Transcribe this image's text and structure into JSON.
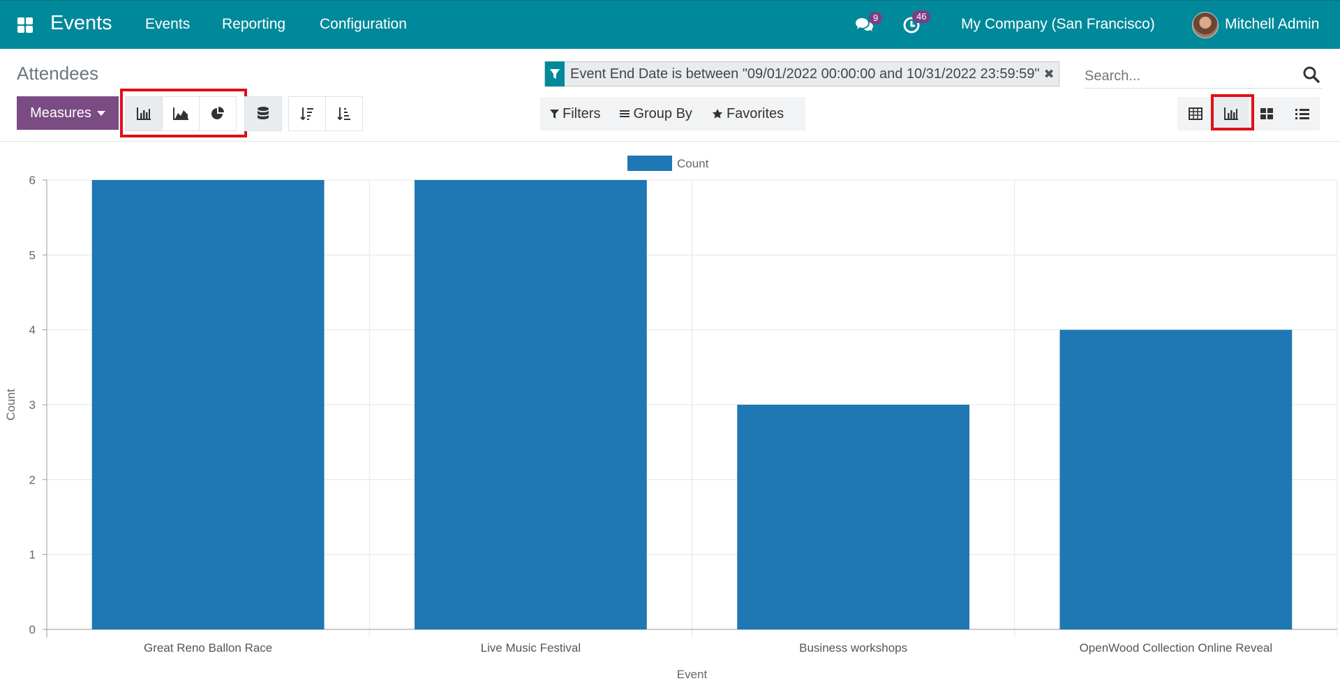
{
  "navbar": {
    "brand": "Events",
    "menu": [
      "Events",
      "Reporting",
      "Configuration"
    ],
    "messages_count": "9",
    "activities_count": "46",
    "company": "My Company (San Francisco)",
    "user": "Mitchell Admin"
  },
  "control_panel": {
    "breadcrumb": "Attendees",
    "measures_label": "Measures",
    "facet_text": "Event End Date is between \"09/01/2022 00:00:00 and 10/31/2022 23:59:59\"",
    "search_placeholder": "Search...",
    "filters_label": "Filters",
    "group_by_label": "Group By",
    "favorites_label": "Favorites"
  },
  "colors": {
    "navbar": "#00899a",
    "measures": "#7b4b83",
    "bar": "#1f77b4",
    "highlight": "#e0101a"
  },
  "chart_data": {
    "type": "bar",
    "categories": [
      "Great Reno Ballon Race",
      "Live Music Festival",
      "Business workshops",
      "OpenWood Collection Online Reveal"
    ],
    "series": [
      {
        "name": "Count",
        "values": [
          6,
          6,
          3,
          4
        ]
      }
    ],
    "xlabel": "Event",
    "ylabel": "Count",
    "ylim": [
      0,
      6
    ],
    "yticks": [
      0,
      1,
      2,
      3,
      4,
      5,
      6
    ],
    "legend": "top-center",
    "grid": true
  }
}
